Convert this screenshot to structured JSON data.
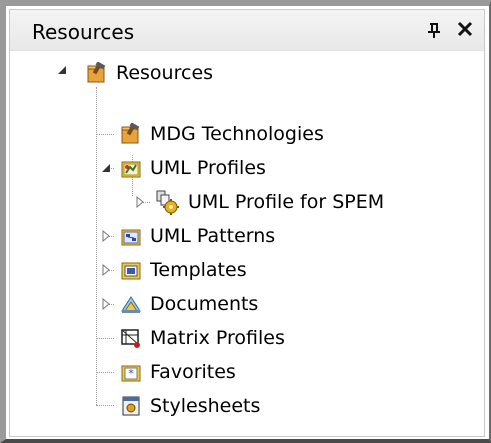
{
  "panel": {
    "title": "Resources",
    "pin_icon": "pin-icon",
    "close_icon": "close-icon"
  },
  "tree": {
    "root": {
      "label": "Resources",
      "icon": "resources-icon",
      "expanded": true
    },
    "items": [
      {
        "label": "MDG Technologies",
        "icon": "mdg-technologies-icon",
        "level": 1
      },
      {
        "label": "UML Profiles",
        "icon": "uml-profiles-icon",
        "level": 1,
        "expanded": true
      },
      {
        "label": "UML Profile for SPEM",
        "icon": "uml-profile-spem-icon",
        "level": 2,
        "collapsed": true
      },
      {
        "label": "UML Patterns",
        "icon": "uml-patterns-icon",
        "level": 1,
        "collapsed": true
      },
      {
        "label": "Templates",
        "icon": "templates-icon",
        "level": 1,
        "collapsed": true
      },
      {
        "label": "Documents",
        "icon": "documents-icon",
        "level": 1,
        "collapsed": true
      },
      {
        "label": "Matrix Profiles",
        "icon": "matrix-profiles-icon",
        "level": 1
      },
      {
        "label": "Favorites",
        "icon": "favorites-icon",
        "level": 1
      },
      {
        "label": "Stylesheets",
        "icon": "stylesheets-icon",
        "level": 1
      }
    ]
  }
}
